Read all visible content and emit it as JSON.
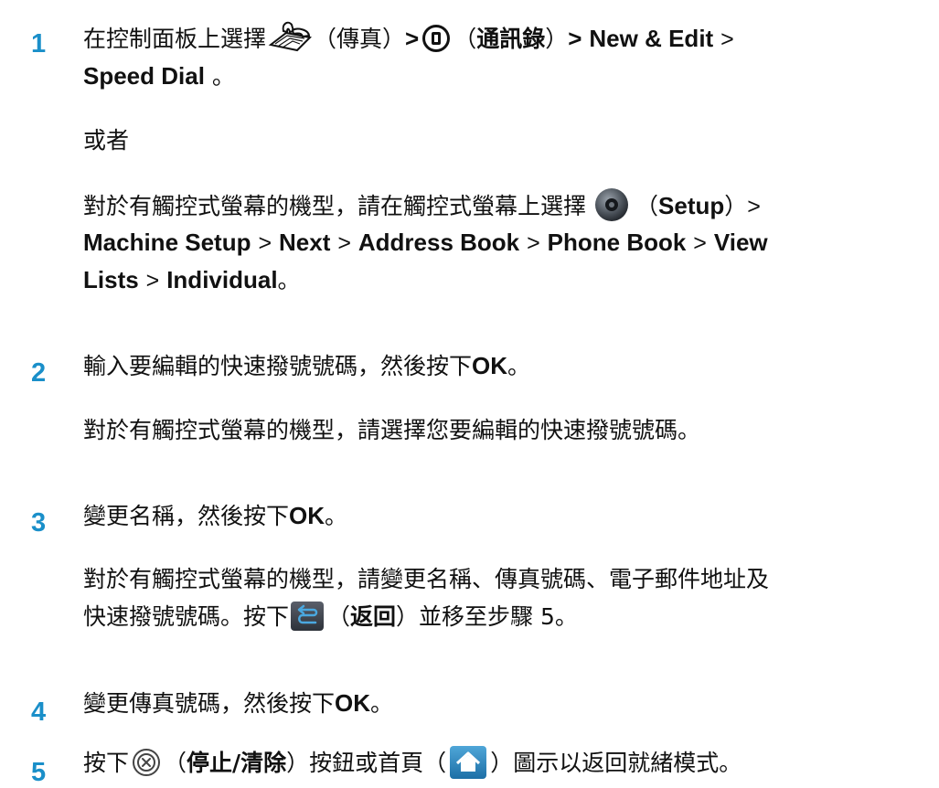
{
  "steps": [
    {
      "number": "1",
      "line1": {
        "pre": "在控制面板上選擇",
        "fax_open": "（傳真）",
        "gt1": ">",
        "book_open": "（",
        "book_label": "通訊錄",
        "book_close": "）",
        "gt2": ">",
        "new_edit": "New & Edit",
        "gt3": ">"
      },
      "line2": {
        "speed_dial": "Speed Dial",
        "end": "。"
      },
      "alt": "或者",
      "touch1": {
        "pre": "對於有觸控式螢幕的機型，請在觸控式螢幕上選擇",
        "open": "（",
        "setup": "Setup",
        "close": "）",
        "gt": ">"
      },
      "touch2": {
        "machine_setup": "Machine Setup",
        "gt1": ">",
        "next": "Next",
        "gt2": ">",
        "address_book": "Address Book",
        "gt3": ">",
        "phone_book": "Phone Book",
        "gt4": ">",
        "view": "View"
      },
      "touch3": {
        "lists": "Lists",
        "gt": ">",
        "individual": "Individual",
        "end": "。"
      }
    },
    {
      "number": "2",
      "main": {
        "pre": "輸入要編輯的快速撥號號碼，然後按下",
        "ok": "OK",
        "end": "。"
      },
      "touch": "對於有觸控式螢幕的機型，請選擇您要編輯的快速撥號號碼。"
    },
    {
      "number": "3",
      "main": {
        "pre": "變更名稱，然後按下",
        "ok": "OK",
        "end": "。"
      },
      "touch1": "對於有觸控式螢幕的機型，請變更名稱、傳真號碼、電子郵件地址及",
      "touch2": {
        "pre": "快速撥號號碼。按下",
        "open": "（",
        "back": "返回",
        "post": "）並移至步驟 5。"
      }
    },
    {
      "number": "4",
      "main": {
        "pre": "變更傳真號碼，然後按下",
        "ok": "OK",
        "end": "。"
      }
    },
    {
      "number": "5",
      "main": {
        "pre": "按下",
        "open1": "（",
        "stop_clear": "停止/清除",
        "mid": "）按鈕或首頁（",
        "post": "）圖示以返回就緒模式。"
      }
    }
  ],
  "colors": {
    "step_number": "#1a8fc9",
    "text": "#111111"
  },
  "icons": [
    "fax-icon",
    "address-book-icon",
    "setup-icon",
    "back-icon",
    "stop-clear-icon",
    "home-icon"
  ]
}
